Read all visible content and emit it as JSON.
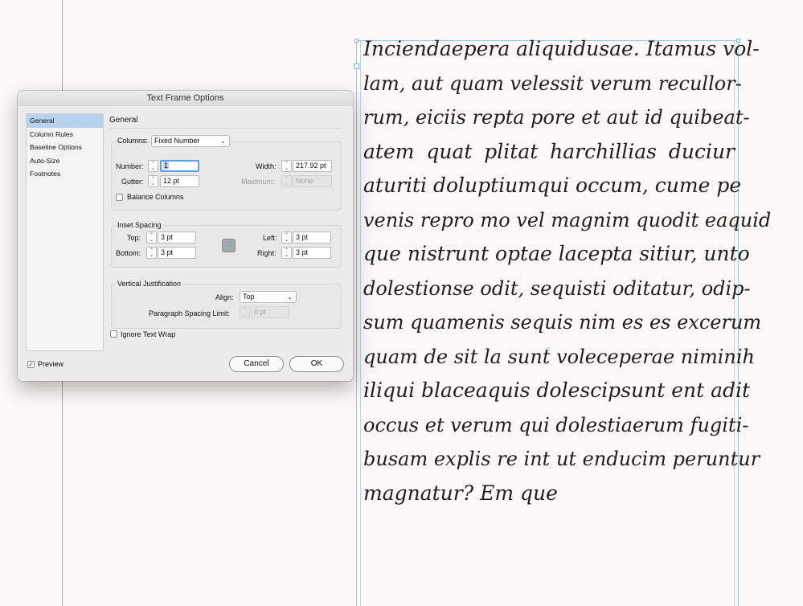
{
  "dialog": {
    "title": "Text Frame Options",
    "sidebar": [
      "General",
      "Column Rules",
      "Baseline Options",
      "Auto-Size",
      "Footnotes"
    ],
    "panel_title": "General",
    "columns": {
      "label": "Columns:",
      "type": "Fixed Number",
      "number_label": "Number:",
      "number": "1",
      "gutter_label": "Gutter:",
      "gutter": "12 pt",
      "width_label": "Width:",
      "width": "217.92 pt",
      "maximum_label": "Maximum:",
      "maximum": "None",
      "balance_label": "Balance Columns",
      "balance_checked": false
    },
    "inset": {
      "legend": "Inset Spacing",
      "top_label": "Top:",
      "top": "3 pt",
      "bottom_label": "Bottom:",
      "bottom": "3 pt",
      "left_label": "Left:",
      "left": "3 pt",
      "right_label": "Right:",
      "right": "3 pt",
      "link_icon": "chain-link-icon"
    },
    "vertical": {
      "legend": "Vertical Justification",
      "align_label": "Align:",
      "align": "Top",
      "spacing_label": "Paragraph Spacing Limit:",
      "spacing": "0 pt"
    },
    "ignore_wrap_label": "Ignore Text Wrap",
    "ignore_wrap_checked": false,
    "preview_label": "Preview",
    "preview_checked": true,
    "cancel_label": "Cancel",
    "ok_label": "OK"
  },
  "text_frame": {
    "lines": [
      "Inciendaepera aliquidusae. Itamus vol-",
      "lam, aut quam velessit verum recullor-",
      "rum, eiciis repta pore et aut id quibeat-",
      "atem quat plitat harchillias duciur",
      "aturiti doluptiumqui occum, cume pe",
      "venis repro mo vel magnim quodit eaquid",
      "que nistrunt optae lacepta sitiur, unto",
      "dolestionse odit, sequisti oditatur, odip-",
      "sum quamenis sequis nim es es excerum",
      "quam de sit la sunt voleceperae niminih",
      "iliqui blaceaquis dolescipsunt ent adit",
      "occus et verum qui dolestiaerum fugiti-",
      "busam explis re int ut enducim peruntur",
      "magnatur? Em que"
    ]
  },
  "colors": {
    "guide": "#c98be6",
    "frame_edge": "#9fc8e8",
    "selection": "#b6d2ee",
    "focus": "#5b9ee8"
  }
}
